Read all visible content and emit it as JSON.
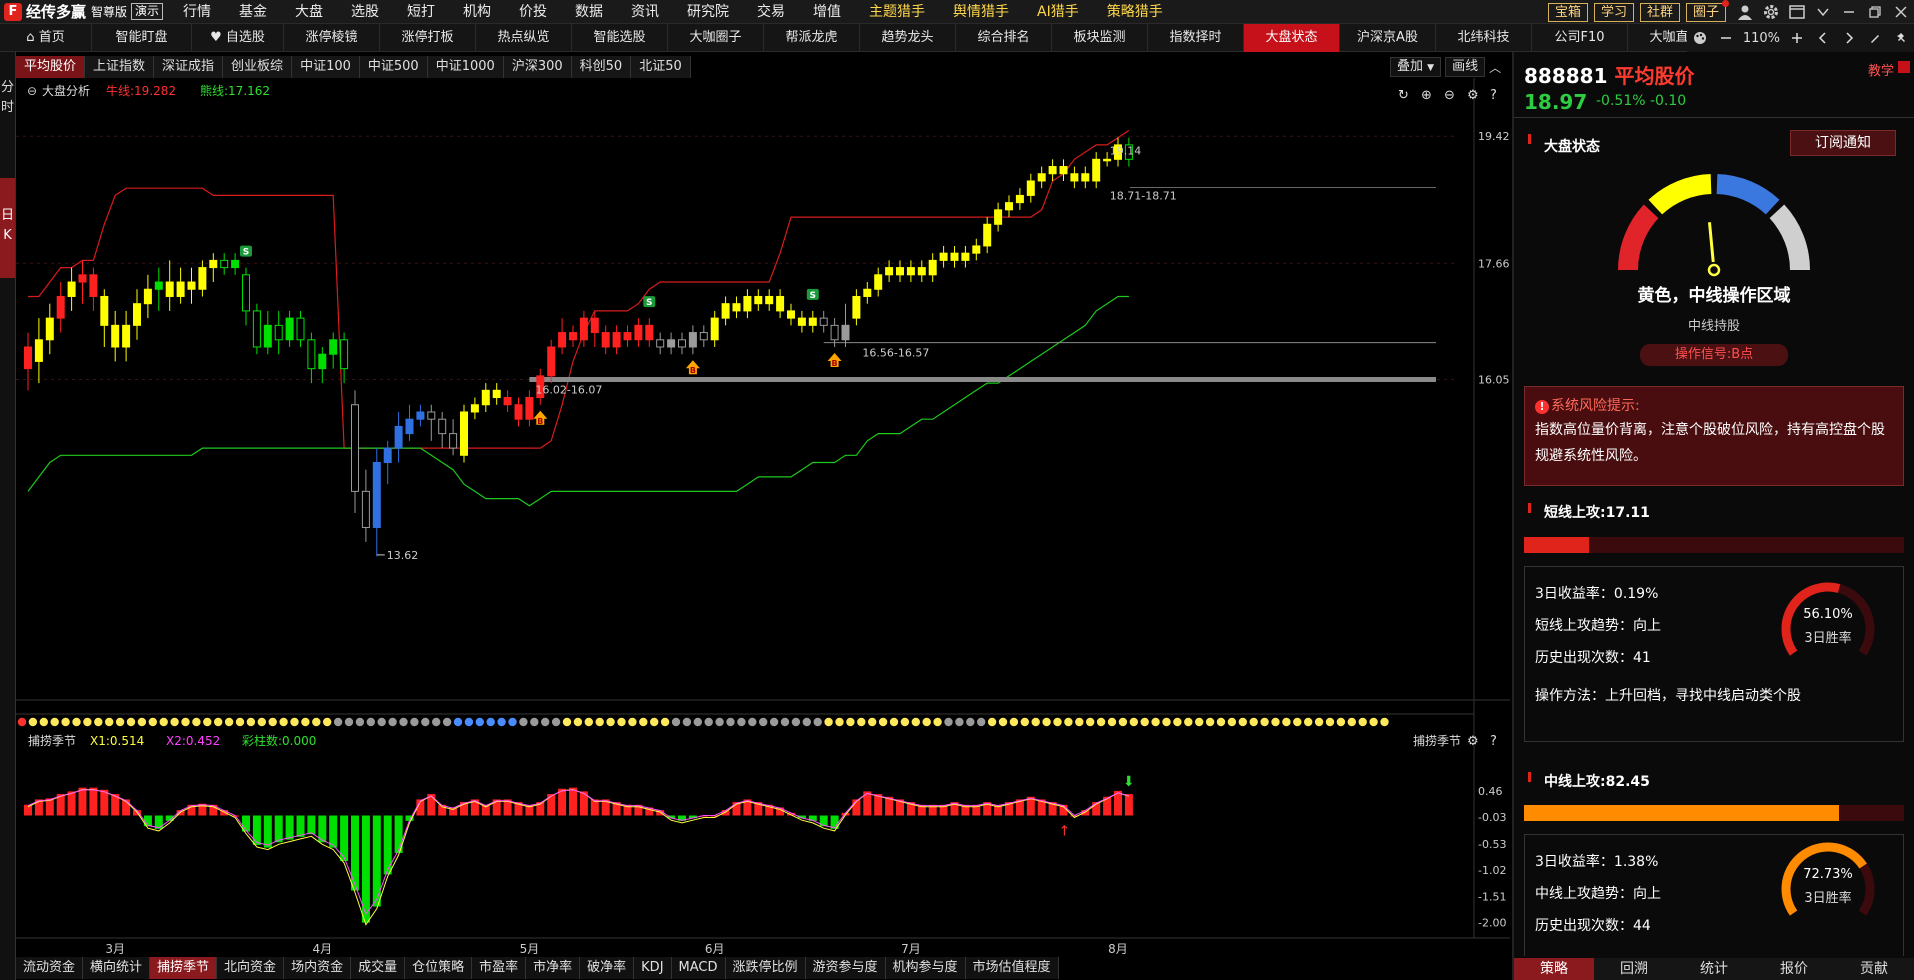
{
  "app": {
    "logo_char": "F",
    "name": "经传多赢",
    "edition": "智尊版",
    "demo": "演示"
  },
  "top_menu": [
    {
      "label": "行情",
      "highlight": false
    },
    {
      "label": "基金",
      "highlight": false
    },
    {
      "label": "大盘",
      "highlight": false
    },
    {
      "label": "选股",
      "highlight": false
    },
    {
      "label": "短打",
      "highlight": false
    },
    {
      "label": "机构",
      "highlight": false
    },
    {
      "label": "价投",
      "highlight": false
    },
    {
      "label": "数据",
      "highlight": false
    },
    {
      "label": "资讯",
      "highlight": false
    },
    {
      "label": "研究院",
      "highlight": false
    },
    {
      "label": "交易",
      "highlight": false
    },
    {
      "label": "增值",
      "highlight": false
    },
    {
      "label": "主题猎手",
      "highlight": true
    },
    {
      "label": "舆情猎手",
      "highlight": true
    },
    {
      "label": "AI猎手",
      "highlight": true
    },
    {
      "label": "策略猎手",
      "highlight": true
    }
  ],
  "top_buttons": [
    "宝箱",
    "学习",
    "社群",
    "圈子"
  ],
  "nav": {
    "items": [
      "首页",
      "智能盯盘",
      "自选股",
      "涨停棱镜",
      "涨停打板",
      "热点纵览",
      "智能选股",
      "大咖圈子",
      "帮派龙虎",
      "趋势龙头",
      "综合排名",
      "板块监测",
      "指数择时",
      "大盘状态",
      "沪深京A股",
      "北纬科技",
      "公司F10",
      "大咖直播"
    ],
    "active": "大盘状态",
    "zoom": "110%"
  },
  "left_tabs": {
    "minute": "分时",
    "day": "日K"
  },
  "sub_tabs": {
    "items": [
      "平均股价",
      "上证指数",
      "深证成指",
      "创业板综",
      "中证100",
      "中证500",
      "中证1000",
      "沪深300",
      "科创50",
      "北证50"
    ],
    "active": "平均股价"
  },
  "chart_ctrl": {
    "overlay": "叠加",
    "draw": "画线"
  },
  "main_chart": {
    "title": "大盘分析",
    "bull_label": "牛线:19.282",
    "bear_label": "熊线:17.162",
    "price_ticks": [
      "19.42",
      "17.66",
      "16.05"
    ],
    "annotations": [
      "19.14",
      "18.71-18.71",
      "16.02-16.07",
      "16.56-16.57",
      "13.62"
    ],
    "signal_b": "B",
    "signal_s": "S"
  },
  "indicator": {
    "title": "捕捞季节",
    "x1": "X1:0.514",
    "x2": "X2:0.452",
    "caishou": "彩柱数:0.000",
    "right_label": "捕捞季节",
    "ticks": [
      "0.46",
      "-0.03",
      "-0.53",
      "-1.02",
      "-1.51",
      "-2.00"
    ]
  },
  "time_axis": [
    "3月",
    "4月",
    "5月",
    "6月",
    "7月",
    "8月"
  ],
  "bottom_tabs": {
    "items": [
      "流动资金",
      "横向统计",
      "捕捞季节",
      "北向资金",
      "场内资金",
      "成交量",
      "仓位策略",
      "市盈率",
      "市净率",
      "破净率",
      "KDJ",
      "MACD",
      "涨跌停比例",
      "游资参与度",
      "机构参与度",
      "市场估值程度"
    ],
    "active": "捕捞季节"
  },
  "stock": {
    "code": "888881",
    "name": "平均股价",
    "price": "18.97",
    "change": "-0.51% -0.10",
    "teach": "教学"
  },
  "market_state": {
    "title": "大盘状态",
    "subscribe": "订阅通知",
    "main": "黄色，中线操作区域",
    "sub": "中线持股",
    "signal": "操作信号:B点",
    "gauge_level": 0.47
  },
  "risk": {
    "title": "系统风险提示:",
    "text": "指数高位量价背离，注意个股破位风险，持有高控盘个股规避系统性风险。"
  },
  "short_attack": {
    "title": "短线上攻:17.11",
    "bar_fraction": 0.17,
    "bar_color": "#e0241b",
    "ret": "3日收益率：0.19%",
    "trend": "短线上攻趋势：向上",
    "count": "历史出现次数：41",
    "method": "操作方法：上升回档，寻找中线启动类个股",
    "win_pct": "56.10%",
    "win_label": "3日胜率",
    "win_value": 0.561,
    "ring_color": "#e0241b"
  },
  "mid_attack": {
    "title": "中线上攻:82.45",
    "bar_fraction": 0.83,
    "bar_color": "#ff8c00",
    "ret": "3日收益率：1.38%",
    "trend": "中线上攻趋势：向上",
    "count": "历史出现次数：44",
    "win_pct": "72.73%",
    "win_label": "3日胜率",
    "win_value": 0.7273,
    "ring_color": "#ff8c00"
  },
  "right_tabs": {
    "items": [
      "策略",
      "回溯",
      "统计",
      "报价",
      "贡献"
    ],
    "active": "策略"
  },
  "colors": {
    "up": "#ff2020",
    "down": "#00e000",
    "yellow": "#ffff00",
    "blue": "#3070e0",
    "gray": "#9a9a9a",
    "bull": "#d81c1c",
    "bear": "#1ec81e"
  },
  "chart_data": {
    "type": "candlestick",
    "title": "大盘分析",
    "ylim": [
      13.3,
      19.7
    ],
    "candles": [
      [
        16.5,
        16.2,
        16.7,
        15.9,
        "r"
      ],
      [
        16.3,
        16.6,
        16.9,
        16.0,
        "y"
      ],
      [
        16.6,
        16.9,
        17.1,
        16.4,
        "y"
      ],
      [
        16.9,
        17.2,
        17.4,
        16.7,
        "r"
      ],
      [
        17.2,
        17.4,
        17.6,
        17.0,
        "y"
      ],
      [
        17.4,
        17.5,
        17.7,
        17.1,
        "r"
      ],
      [
        17.5,
        17.2,
        17.6,
        17.0,
        "r"
      ],
      [
        17.2,
        16.8,
        17.3,
        16.5,
        "y"
      ],
      [
        16.8,
        16.5,
        17.0,
        16.3,
        "y"
      ],
      [
        16.5,
        16.8,
        17.0,
        16.3,
        "y"
      ],
      [
        16.8,
        17.1,
        17.3,
        16.6,
        "y"
      ],
      [
        17.1,
        17.3,
        17.5,
        16.9,
        "y"
      ],
      [
        17.3,
        17.4,
        17.6,
        17.0,
        "g"
      ],
      [
        17.4,
        17.2,
        17.7,
        17.0,
        "y"
      ],
      [
        17.2,
        17.4,
        17.6,
        17.1,
        "y"
      ],
      [
        17.4,
        17.3,
        17.6,
        17.1,
        "y"
      ],
      [
        17.3,
        17.6,
        17.7,
        17.2,
        "y"
      ],
      [
        17.6,
        17.7,
        17.8,
        17.4,
        "y"
      ],
      [
        17.7,
        17.6,
        17.8,
        17.5,
        "g"
      ],
      [
        17.6,
        17.7,
        17.8,
        17.5,
        "g"
      ],
      [
        17.5,
        17.0,
        17.6,
        16.8,
        "g"
      ],
      [
        17.0,
        16.5,
        17.1,
        16.4,
        "g"
      ],
      [
        16.5,
        16.8,
        17.0,
        16.4,
        "g"
      ],
      [
        16.8,
        16.6,
        17.0,
        16.4,
        "g"
      ],
      [
        16.6,
        16.9,
        17.0,
        16.5,
        "g"
      ],
      [
        16.9,
        16.6,
        17.0,
        16.5,
        "g"
      ],
      [
        16.6,
        16.2,
        16.7,
        16.0,
        "g"
      ],
      [
        16.2,
        16.4,
        16.5,
        16.0,
        "g"
      ],
      [
        16.4,
        16.6,
        16.7,
        16.2,
        "g"
      ],
      [
        16.6,
        16.2,
        16.7,
        16.0,
        "g"
      ],
      [
        15.7,
        14.5,
        15.9,
        14.2,
        "x"
      ],
      [
        14.5,
        14.0,
        14.8,
        13.8,
        "x"
      ],
      [
        14.0,
        14.9,
        15.1,
        13.6,
        "b"
      ],
      [
        14.9,
        15.1,
        15.2,
        14.6,
        "b"
      ],
      [
        15.1,
        15.4,
        15.6,
        14.9,
        "b"
      ],
      [
        15.3,
        15.5,
        15.7,
        15.2,
        "b"
      ],
      [
        15.5,
        15.6,
        15.7,
        15.4,
        "b"
      ],
      [
        15.6,
        15.5,
        15.7,
        15.2,
        "x"
      ],
      [
        15.5,
        15.3,
        15.6,
        15.1,
        "x"
      ],
      [
        15.3,
        15.1,
        15.5,
        15.0,
        "x"
      ],
      [
        15.0,
        15.6,
        15.7,
        14.9,
        "y"
      ],
      [
        15.6,
        15.7,
        15.8,
        15.5,
        "y"
      ],
      [
        15.7,
        15.9,
        16.0,
        15.6,
        "y"
      ],
      [
        15.9,
        15.8,
        16.0,
        15.7,
        "y"
      ],
      [
        15.8,
        15.7,
        15.9,
        15.6,
        "r"
      ],
      [
        15.7,
        15.5,
        15.8,
        15.4,
        "r"
      ],
      [
        15.5,
        15.8,
        15.9,
        15.4,
        "r"
      ],
      [
        15.8,
        16.1,
        16.2,
        15.7,
        "r"
      ],
      [
        16.1,
        16.5,
        16.6,
        16.0,
        "r"
      ],
      [
        16.5,
        16.7,
        16.9,
        16.4,
        "r"
      ],
      [
        16.7,
        16.6,
        16.8,
        16.5,
        "r"
      ],
      [
        16.6,
        16.9,
        17.0,
        16.5,
        "r"
      ],
      [
        16.9,
        16.7,
        17.0,
        16.5,
        "r"
      ],
      [
        16.7,
        16.5,
        16.8,
        16.4,
        "r"
      ],
      [
        16.5,
        16.7,
        16.8,
        16.4,
        "r"
      ],
      [
        16.7,
        16.6,
        16.8,
        16.5,
        "r"
      ],
      [
        16.6,
        16.8,
        16.9,
        16.5,
        "r"
      ],
      [
        16.8,
        16.6,
        16.9,
        16.5,
        "r"
      ],
      [
        16.6,
        16.5,
        16.7,
        16.4,
        "x"
      ],
      [
        16.5,
        16.6,
        16.7,
        16.4,
        "x"
      ],
      [
        16.6,
        16.5,
        16.7,
        16.4,
        "x"
      ],
      [
        16.5,
        16.7,
        16.8,
        16.4,
        "x"
      ],
      [
        16.7,
        16.6,
        16.8,
        16.5,
        "x"
      ],
      [
        16.6,
        16.9,
        17.0,
        16.5,
        "y"
      ],
      [
        16.9,
        17.1,
        17.2,
        16.8,
        "y"
      ],
      [
        17.1,
        17.0,
        17.2,
        16.9,
        "y"
      ],
      [
        17.0,
        17.2,
        17.3,
        16.9,
        "y"
      ],
      [
        17.2,
        17.1,
        17.3,
        17.0,
        "y"
      ],
      [
        17.1,
        17.2,
        17.3,
        17.0,
        "y"
      ],
      [
        17.2,
        17.0,
        17.3,
        16.9,
        "y"
      ],
      [
        17.0,
        16.9,
        17.1,
        16.8,
        "y"
      ],
      [
        16.9,
        16.8,
        17.0,
        16.7,
        "y"
      ],
      [
        16.8,
        16.9,
        17.0,
        16.7,
        "y"
      ],
      [
        16.9,
        16.8,
        17.0,
        16.7,
        "x"
      ],
      [
        16.8,
        16.6,
        16.9,
        16.5,
        "x"
      ],
      [
        16.6,
        16.8,
        17.1,
        16.5,
        "x"
      ],
      [
        16.9,
        17.2,
        17.3,
        16.8,
        "y"
      ],
      [
        17.2,
        17.3,
        17.4,
        17.1,
        "y"
      ],
      [
        17.3,
        17.5,
        17.6,
        17.2,
        "y"
      ],
      [
        17.5,
        17.6,
        17.7,
        17.4,
        "y"
      ],
      [
        17.6,
        17.5,
        17.7,
        17.4,
        "y"
      ],
      [
        17.5,
        17.6,
        17.7,
        17.4,
        "y"
      ],
      [
        17.6,
        17.5,
        17.7,
        17.4,
        "y"
      ],
      [
        17.5,
        17.7,
        17.8,
        17.4,
        "y"
      ],
      [
        17.7,
        17.8,
        17.9,
        17.6,
        "y"
      ],
      [
        17.8,
        17.7,
        17.9,
        17.6,
        "y"
      ],
      [
        17.7,
        17.8,
        17.9,
        17.6,
        "y"
      ],
      [
        17.8,
        17.9,
        18.0,
        17.7,
        "y"
      ],
      [
        17.9,
        18.2,
        18.3,
        17.8,
        "y"
      ],
      [
        18.2,
        18.4,
        18.5,
        18.1,
        "y"
      ],
      [
        18.4,
        18.5,
        18.6,
        18.3,
        "y"
      ],
      [
        18.5,
        18.6,
        18.7,
        18.4,
        "y"
      ],
      [
        18.6,
        18.8,
        18.9,
        18.5,
        "y"
      ],
      [
        18.8,
        18.9,
        19.0,
        18.7,
        "y"
      ],
      [
        18.9,
        19.0,
        19.1,
        18.8,
        "y"
      ],
      [
        19.0,
        18.9,
        19.1,
        18.8,
        "y"
      ],
      [
        18.9,
        18.8,
        19.0,
        18.7,
        "y"
      ],
      [
        18.8,
        18.9,
        19.0,
        18.7,
        "y"
      ],
      [
        18.8,
        19.1,
        19.2,
        18.7,
        "y"
      ],
      [
        19.1,
        19.1,
        19.2,
        19.0,
        "y"
      ],
      [
        19.1,
        19.3,
        19.4,
        19.0,
        "y"
      ],
      [
        19.3,
        19.1,
        19.4,
        19.0,
        "g"
      ]
    ],
    "bull_line": [
      17.2,
      17.2,
      17.4,
      17.6,
      17.6,
      17.7,
      17.7,
      18.2,
      18.6,
      18.7,
      18.7,
      18.7,
      18.7,
      18.7,
      18.7,
      18.7,
      18.7,
      18.6,
      18.6,
      18.6,
      18.6,
      18.6,
      18.6,
      18.6,
      18.6,
      18.6,
      18.6,
      18.6,
      18.6,
      15.1,
      15.1,
      15.1,
      15.1,
      15.1,
      15.1,
      15.1,
      15.1,
      15.1,
      15.1,
      15.1,
      15.1,
      15.1,
      15.1,
      15.1,
      15.1,
      15.1,
      15.1,
      15.1,
      15.2,
      15.7,
      16.3,
      16.7,
      17.0,
      17.0,
      17.0,
      17.0,
      17.1,
      17.3,
      17.4,
      17.4,
      17.4,
      17.4,
      17.4,
      17.4,
      17.4,
      17.4,
      17.4,
      17.4,
      17.4,
      17.8,
      18.3,
      18.3,
      18.3,
      18.3,
      18.3,
      18.3,
      18.3,
      18.3,
      18.3,
      18.3,
      18.3,
      18.3,
      18.3,
      18.3,
      18.3,
      18.3,
      18.3,
      18.3,
      18.3,
      18.3,
      18.3,
      18.3,
      18.3,
      18.4,
      18.8,
      18.9,
      19.1,
      19.2,
      19.3,
      19.3,
      19.4,
      19.5
    ],
    "bear_line": [
      14.5,
      14.7,
      14.9,
      15.0,
      15.0,
      15.0,
      15.0,
      15.0,
      15.0,
      15.0,
      15.0,
      15.0,
      15.0,
      15.0,
      15.0,
      15.0,
      15.1,
      15.1,
      15.1,
      15.1,
      15.1,
      15.1,
      15.1,
      15.1,
      15.1,
      15.1,
      15.1,
      15.1,
      15.1,
      15.1,
      15.1,
      15.1,
      15.1,
      15.1,
      15.1,
      15.1,
      15.1,
      15.0,
      14.9,
      14.8,
      14.6,
      14.5,
      14.4,
      14.4,
      14.4,
      14.4,
      14.3,
      14.4,
      14.5,
      14.5,
      14.5,
      14.5,
      14.5,
      14.5,
      14.5,
      14.5,
      14.5,
      14.5,
      14.5,
      14.5,
      14.5,
      14.5,
      14.5,
      14.5,
      14.5,
      14.5,
      14.6,
      14.7,
      14.7,
      14.7,
      14.7,
      14.8,
      14.9,
      14.9,
      14.9,
      15.0,
      15.0,
      15.2,
      15.3,
      15.3,
      15.3,
      15.4,
      15.5,
      15.5,
      15.6,
      15.7,
      15.8,
      15.9,
      16.0,
      16.0,
      16.1,
      16.2,
      16.3,
      16.4,
      16.5,
      16.6,
      16.7,
      16.8,
      17.0,
      17.1,
      17.2,
      17.2
    ],
    "signals": [
      {
        "i": 47,
        "type": "B"
      },
      {
        "i": 61,
        "type": "B"
      },
      {
        "i": 74,
        "type": "B"
      },
      {
        "i": 20,
        "type": "S"
      },
      {
        "i": 57,
        "type": "S"
      },
      {
        "i": 72,
        "type": "S"
      }
    ],
    "support_lines": [
      {
        "from": 46,
        "to": 102,
        "value": 16.05
      },
      {
        "from": 73,
        "to": 102,
        "value": 16.56
      }
    ],
    "indicator_bars": [
      0.2,
      0.3,
      0.32,
      0.4,
      0.45,
      0.52,
      0.52,
      0.48,
      0.4,
      0.3,
      0.1,
      -0.2,
      -0.25,
      -0.1,
      0.1,
      0.2,
      0.22,
      0.2,
      0.1,
      0.0,
      -0.3,
      -0.55,
      -0.6,
      -0.5,
      -0.45,
      -0.4,
      -0.35,
      -0.5,
      -0.6,
      -0.85,
      -1.4,
      -2.0,
      -1.7,
      -1.1,
      -0.7,
      -0.1,
      0.3,
      0.4,
      0.2,
      0.15,
      0.25,
      0.3,
      0.2,
      0.3,
      0.3,
      0.25,
      0.2,
      0.25,
      0.4,
      0.5,
      0.52,
      0.45,
      0.3,
      0.3,
      0.25,
      0.2,
      0.2,
      0.15,
      0.1,
      -0.05,
      -0.1,
      -0.05,
      0.0,
      0.0,
      0.1,
      0.25,
      0.3,
      0.25,
      0.2,
      0.15,
      0.05,
      -0.05,
      -0.1,
      -0.2,
      -0.25,
      0.05,
      0.3,
      0.45,
      0.4,
      0.35,
      0.3,
      0.25,
      0.2,
      0.2,
      0.2,
      0.25,
      0.2,
      0.2,
      0.25,
      0.2,
      0.25,
      0.3,
      0.35,
      0.3,
      0.25,
      0.2,
      0.0,
      0.1,
      0.25,
      0.35,
      0.46,
      0.4
    ],
    "dot_colors": [
      "r",
      "y",
      "y",
      "y",
      "y",
      "y",
      "y",
      "y",
      "y",
      "y",
      "y",
      "y",
      "y",
      "y",
      "y",
      "y",
      "y",
      "y",
      "y",
      "y",
      "y",
      "y",
      "y",
      "y",
      "y",
      "y",
      "y",
      "y",
      "y",
      "x",
      "x",
      "x",
      "x",
      "x",
      "x",
      "x",
      "x",
      "x",
      "x",
      "x",
      "b",
      "b",
      "b",
      "b",
      "b",
      "b",
      "x",
      "x",
      "x",
      "x",
      "y",
      "y",
      "y",
      "y",
      "y",
      "y",
      "y",
      "y",
      "y",
      "y",
      "x",
      "x",
      "x",
      "x",
      "x",
      "x",
      "x",
      "x",
      "x",
      "x",
      "x",
      "x",
      "x",
      "x",
      "y",
      "y",
      "y",
      "y",
      "y",
      "y",
      "y",
      "y",
      "y",
      "y",
      "y",
      "x",
      "x",
      "x",
      "x",
      "y",
      "y",
      "y",
      "y",
      "y",
      "y",
      "y",
      "y",
      "y",
      "y",
      "y",
      "y",
      "y",
      "y",
      "y",
      "y",
      "y",
      "y",
      "y",
      "y",
      "y",
      "y",
      "y",
      "y",
      "y",
      "y",
      "y",
      "y",
      "y",
      "y",
      "y",
      "y",
      "y",
      "y",
      "y",
      "y",
      "y"
    ]
  }
}
